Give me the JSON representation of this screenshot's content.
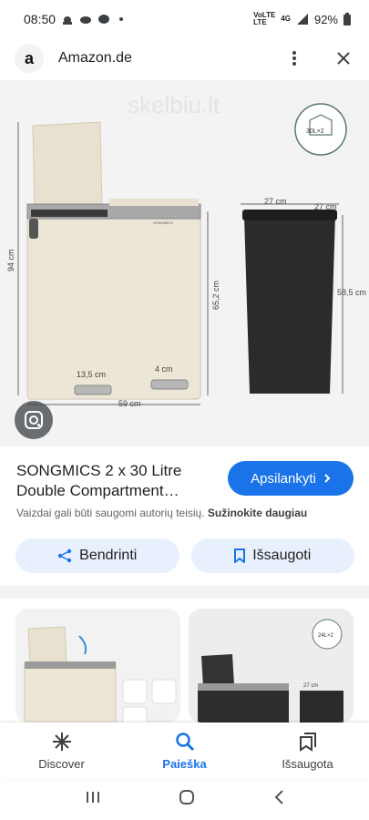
{
  "status": {
    "time": "08:50",
    "battery": "92%",
    "network": "4G",
    "volte": "VoLTE",
    "lte": "LTE"
  },
  "browser": {
    "site_name": "Amazon.de",
    "favicon_letter": "a"
  },
  "image": {
    "watermark": "skelbiu.lt",
    "badge": "30L×2",
    "brand": "SONGMICS",
    "dims": {
      "height_total": "94 cm",
      "inner_height": "65,2 cm",
      "width": "59 cm",
      "pedal_a": "13,5 cm",
      "pedal_b": "4 cm",
      "bin_width_a": "27 cm",
      "bin_width_b": "27 cm",
      "bin_height": "58,5 cm"
    }
  },
  "product": {
    "title_line1": "SONGMICS 2 x 30 Litre",
    "title_line2": "Double Compartment…",
    "visit_label": "Apsilankyti",
    "copyright_text": "Vaizdai gali būti saugomi autorių teisių.",
    "learn_more": "Sužinokite daugiau",
    "share_label": "Bendrinti",
    "save_label": "Išsaugoti"
  },
  "thumbs": {
    "thumb2_badge": "24L×2",
    "thumb2_dim": "27 cm"
  },
  "nav": {
    "items": [
      {
        "label": "Discover"
      },
      {
        "label": "Paieška"
      },
      {
        "label": "Išsaugota"
      }
    ]
  },
  "colors": {
    "accent": "#1a73e8",
    "pill_bg": "#e8f0fe",
    "bin_cream": "#ece6d6",
    "bin_black": "#2b2b2b"
  }
}
